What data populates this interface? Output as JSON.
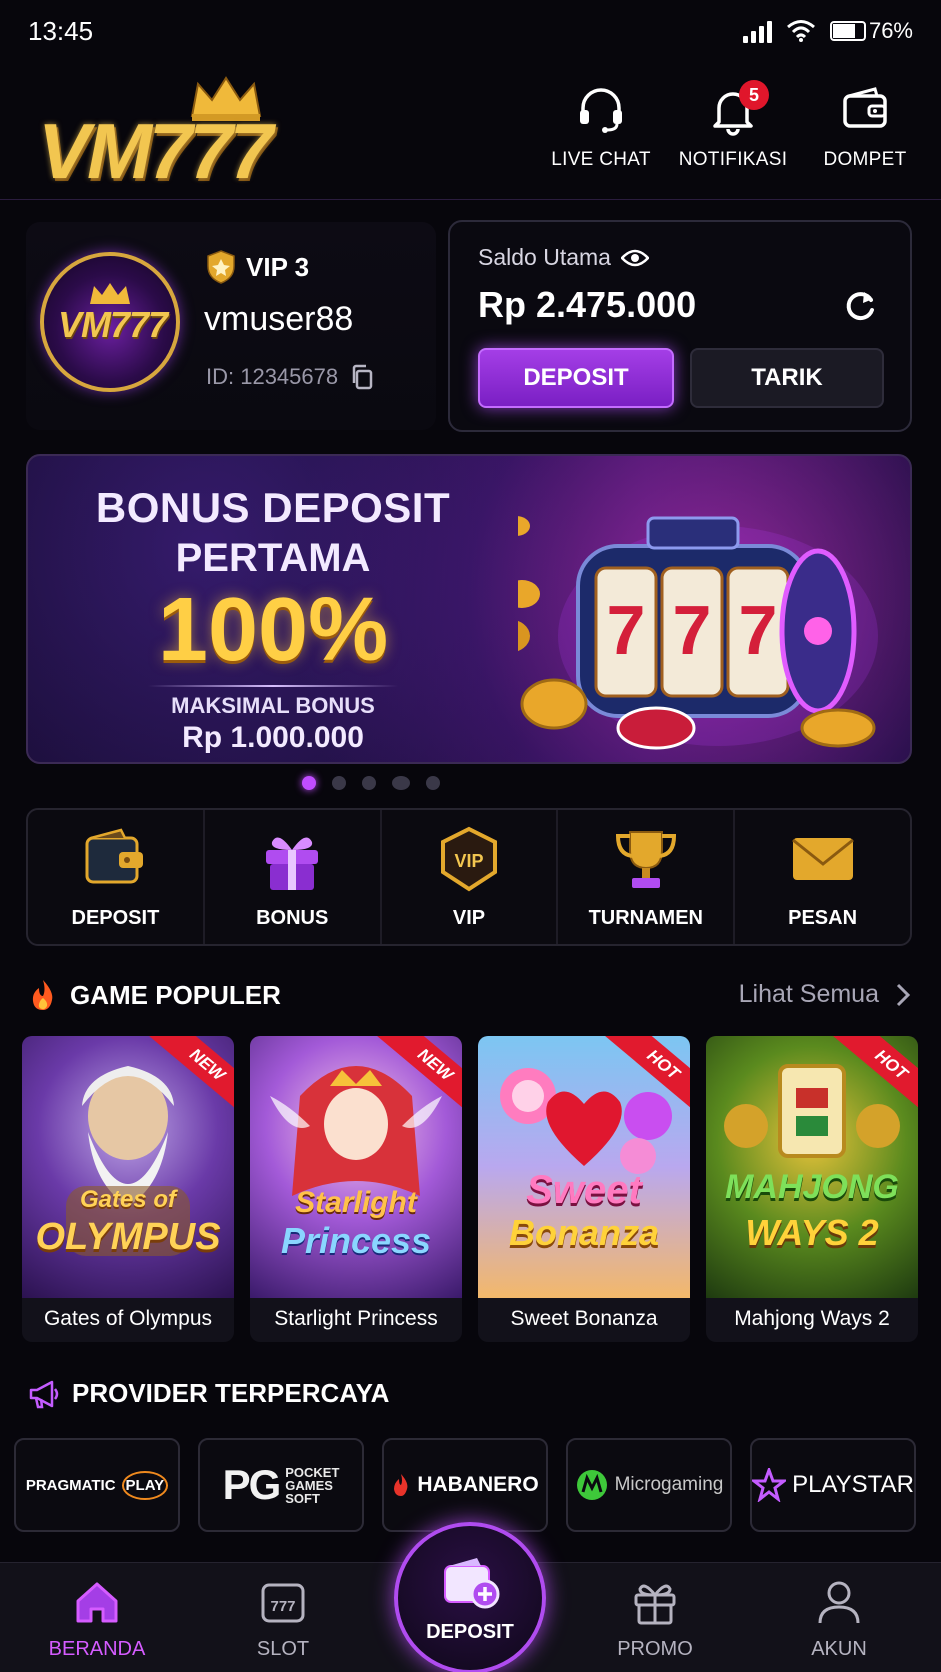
{
  "status_bar": {
    "time": "13:45",
    "battery": "76%",
    "battery_level": 0.76
  },
  "header": {
    "logo_text": "VM777",
    "actions": [
      {
        "label": "LIVE CHAT",
        "icon": "headset-icon"
      },
      {
        "label": "NOTIFIKASI",
        "icon": "bell-icon",
        "badge": "5"
      },
      {
        "label": "DOMPET",
        "icon": "wallet-icon"
      }
    ]
  },
  "profile": {
    "avatar_text": "VM777",
    "vip": "VIP 3",
    "username": "vmuser88",
    "user_id": "ID: 12345678"
  },
  "balance": {
    "label": "Saldo Utama",
    "amount": "Rp 2.475.000",
    "deposit_label": "DEPOSIT",
    "withdraw_label": "TARIK"
  },
  "banner": {
    "line1": "BONUS DEPOSIT",
    "line2": "PERTAMA",
    "percent": "100%",
    "max_label": "MAKSIMAL BONUS",
    "max_amount": "Rp 1.000.000",
    "slot_symbols": "777",
    "slide_count": 5,
    "active_slide": 1
  },
  "quick_menu": [
    {
      "label": "DEPOSIT",
      "icon": "wallet-icon"
    },
    {
      "label": "BONUS",
      "icon": "gift-icon"
    },
    {
      "label": "VIP",
      "icon": "vip-badge-icon"
    },
    {
      "label": "TURNAMEN",
      "icon": "trophy-icon"
    },
    {
      "label": "PESAN",
      "icon": "envelope-icon"
    }
  ],
  "games_section": {
    "title": "GAME POPULER",
    "see_all": "Lihat Semua",
    "games": [
      {
        "name": "Gates of Olympus",
        "tag": "NEW",
        "art_line1": "Gates of",
        "art_line2": "OLYMPUS"
      },
      {
        "name": "Starlight Princess",
        "tag": "NEW",
        "art_line1": "Starlight",
        "art_line2": "Princess"
      },
      {
        "name": "Sweet Bonanza",
        "tag": "HOT",
        "art_line1": "Sweet",
        "art_line2": "Bonanza"
      },
      {
        "name": "Mahjong Ways 2",
        "tag": "HOT",
        "art_line1": "MAHJONG",
        "art_line2": "WAYS 2"
      }
    ]
  },
  "providers_section": {
    "title": "PROVIDER TERPERCAYA",
    "providers": [
      {
        "name": "PRAGMATIC PLAY",
        "mark": "PRAGMATIC",
        "mark2": "PLAY"
      },
      {
        "name": "PG Soft",
        "mark": "PG",
        "sub1": "POCKET",
        "sub2": "GAMES",
        "sub3": "SOFT"
      },
      {
        "name": "HABANERO",
        "mark": "HABANERO"
      },
      {
        "name": "Microgaming",
        "mark": "Microgaming"
      },
      {
        "name": "PLAYSTAR",
        "mark": "PLAYSTAR"
      }
    ]
  },
  "bottom_nav": {
    "items": [
      {
        "label": "BERANDA",
        "icon": "home-icon",
        "active": true
      },
      {
        "label": "SLOT",
        "icon": "slot-machine-icon"
      },
      {
        "label": "DEPOSIT",
        "icon": "wallet-plus-icon"
      },
      {
        "label": "PROMO",
        "icon": "gift-icon"
      },
      {
        "label": "AKUN",
        "icon": "user-icon"
      }
    ]
  },
  "colors": {
    "accent_purple": "#b04cf0",
    "gold": "#f2c650",
    "badge_red": "#e0162b",
    "background": "#07060c"
  }
}
